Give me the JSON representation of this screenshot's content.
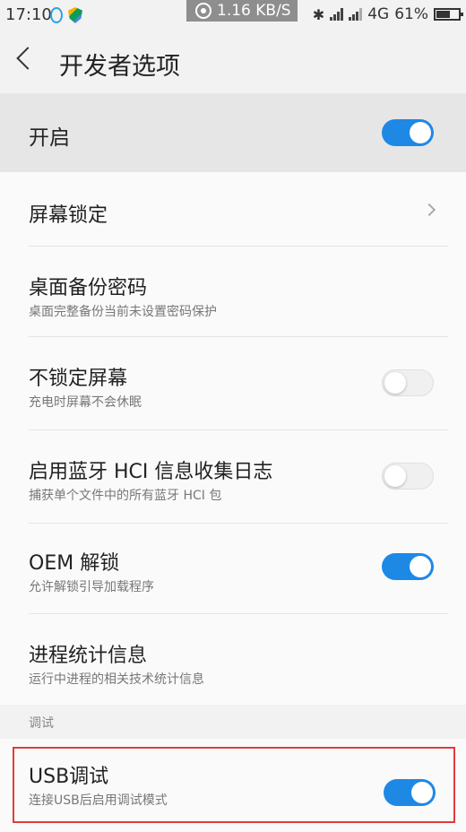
{
  "status_bar": {
    "time": "17:10",
    "net_speed": "1.16 KB/S",
    "bluetooth": "✱",
    "network_type": "4G",
    "battery": "61%"
  },
  "header": {
    "back_icon": "chevron-left-icon",
    "title": "开发者选项"
  },
  "main_toggle": {
    "label": "开启",
    "on": true
  },
  "items": [
    {
      "title": "屏幕锁定",
      "subtitle": "",
      "control": "chevron"
    },
    {
      "title": "桌面备份密码",
      "subtitle": "桌面完整备份当前未设置密码保护",
      "control": "none"
    },
    {
      "title": "不锁定屏幕",
      "subtitle": "充电时屏幕不会休眠",
      "control": "toggle",
      "on": false
    },
    {
      "title": "启用蓝牙 HCI 信息收集日志",
      "subtitle": "捕获单个文件中的所有蓝牙 HCI 包",
      "control": "toggle",
      "on": false
    },
    {
      "title": "OEM 解锁",
      "subtitle": "允许解锁引导加载程序",
      "control": "toggle",
      "on": true
    },
    {
      "title": "进程统计信息",
      "subtitle": "运行中进程的相关技术统计信息",
      "control": "none"
    }
  ],
  "section_debug": "调试",
  "usb_debug": {
    "title": "USB调试",
    "subtitle": "连接USB后启用调试模式",
    "on": true
  },
  "colors": {
    "accent": "#1e88e5",
    "highlight": "#e23b3b"
  }
}
